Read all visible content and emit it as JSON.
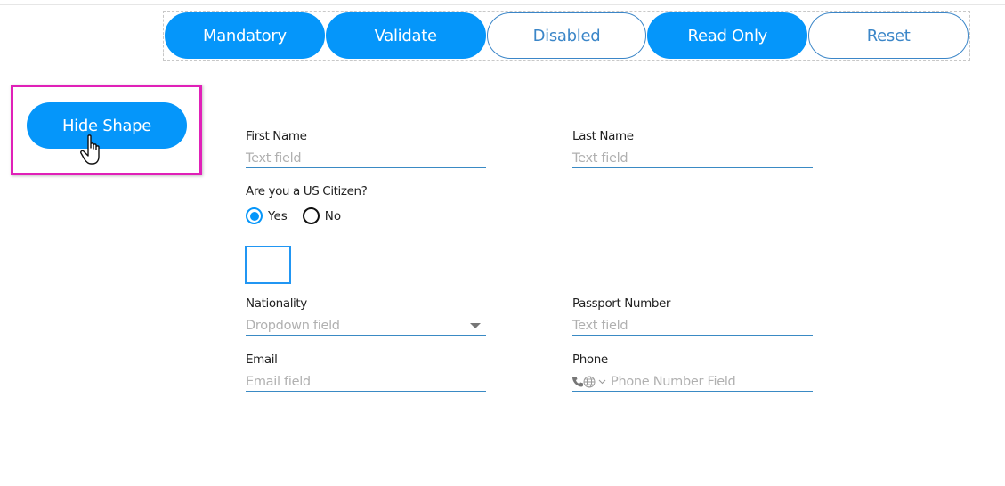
{
  "toolbar": {
    "buttons": [
      {
        "label": "Mandatory",
        "style": "filled"
      },
      {
        "label": "Validate",
        "style": "filled"
      },
      {
        "label": "Disabled",
        "style": "outline"
      },
      {
        "label": "Read Only",
        "style": "filled"
      },
      {
        "label": "Reset",
        "style": "outline"
      }
    ]
  },
  "hide_shape": {
    "label": "Hide Shape"
  },
  "form": {
    "first_name": {
      "label": "First Name",
      "placeholder": "Text field"
    },
    "last_name": {
      "label": "Last Name",
      "placeholder": "Text field"
    },
    "citizen": {
      "question": "Are you a US Citizen?",
      "options": [
        {
          "label": "Yes",
          "selected": true
        },
        {
          "label": "No",
          "selected": false
        }
      ]
    },
    "nationality": {
      "label": "Nationality",
      "placeholder": "Dropdown field"
    },
    "passport": {
      "label": "Passport Number",
      "placeholder": "Text field"
    },
    "email": {
      "label": "Email",
      "placeholder": "Email field"
    },
    "phone": {
      "label": "Phone",
      "placeholder": "Phone Number Field"
    }
  },
  "colors": {
    "accent": "#0596fa",
    "outline": "#3b86c8",
    "highlight": "#e020b8"
  }
}
